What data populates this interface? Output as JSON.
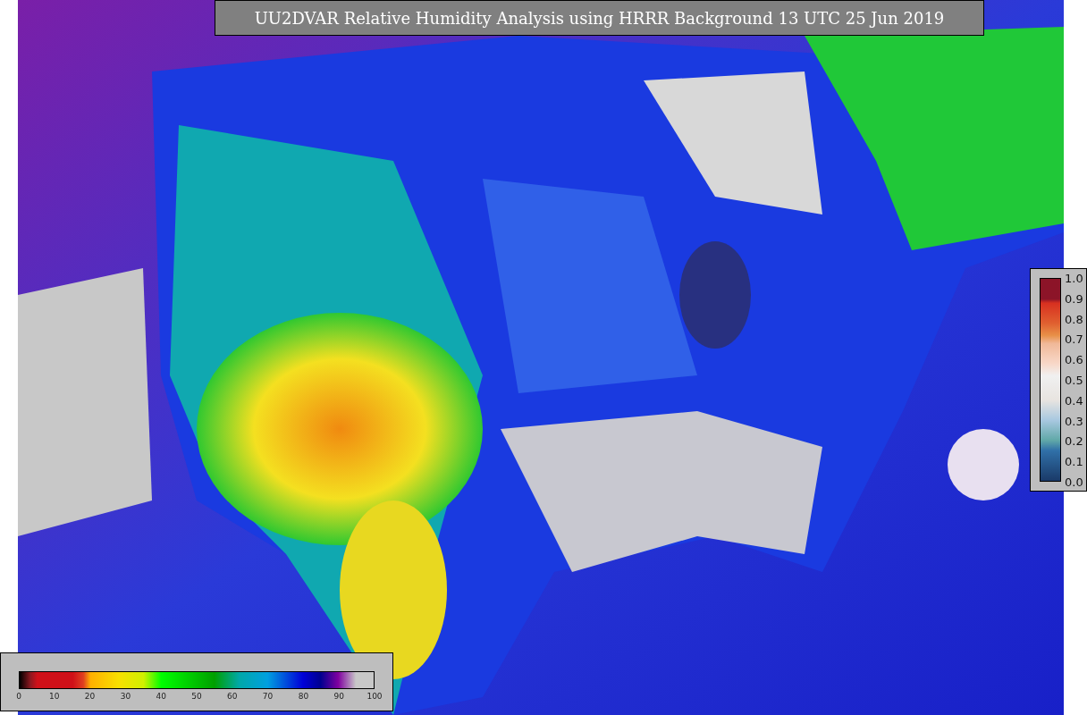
{
  "title": "UU2DVAR Relative Humidity Analysis using HRRR Background 13 UTC 25 Jun 2019",
  "humidity_colorbar": {
    "ticks": [
      "0",
      "10",
      "20",
      "30",
      "40",
      "50",
      "60",
      "70",
      "80",
      "90",
      "100"
    ]
  },
  "ratio_colorbar": {
    "ticks": [
      "1.0",
      "0.9",
      "0.8",
      "0.7",
      "0.6",
      "0.5",
      "0.4",
      "0.3",
      "0.2",
      "0.1",
      "0.0"
    ]
  }
}
